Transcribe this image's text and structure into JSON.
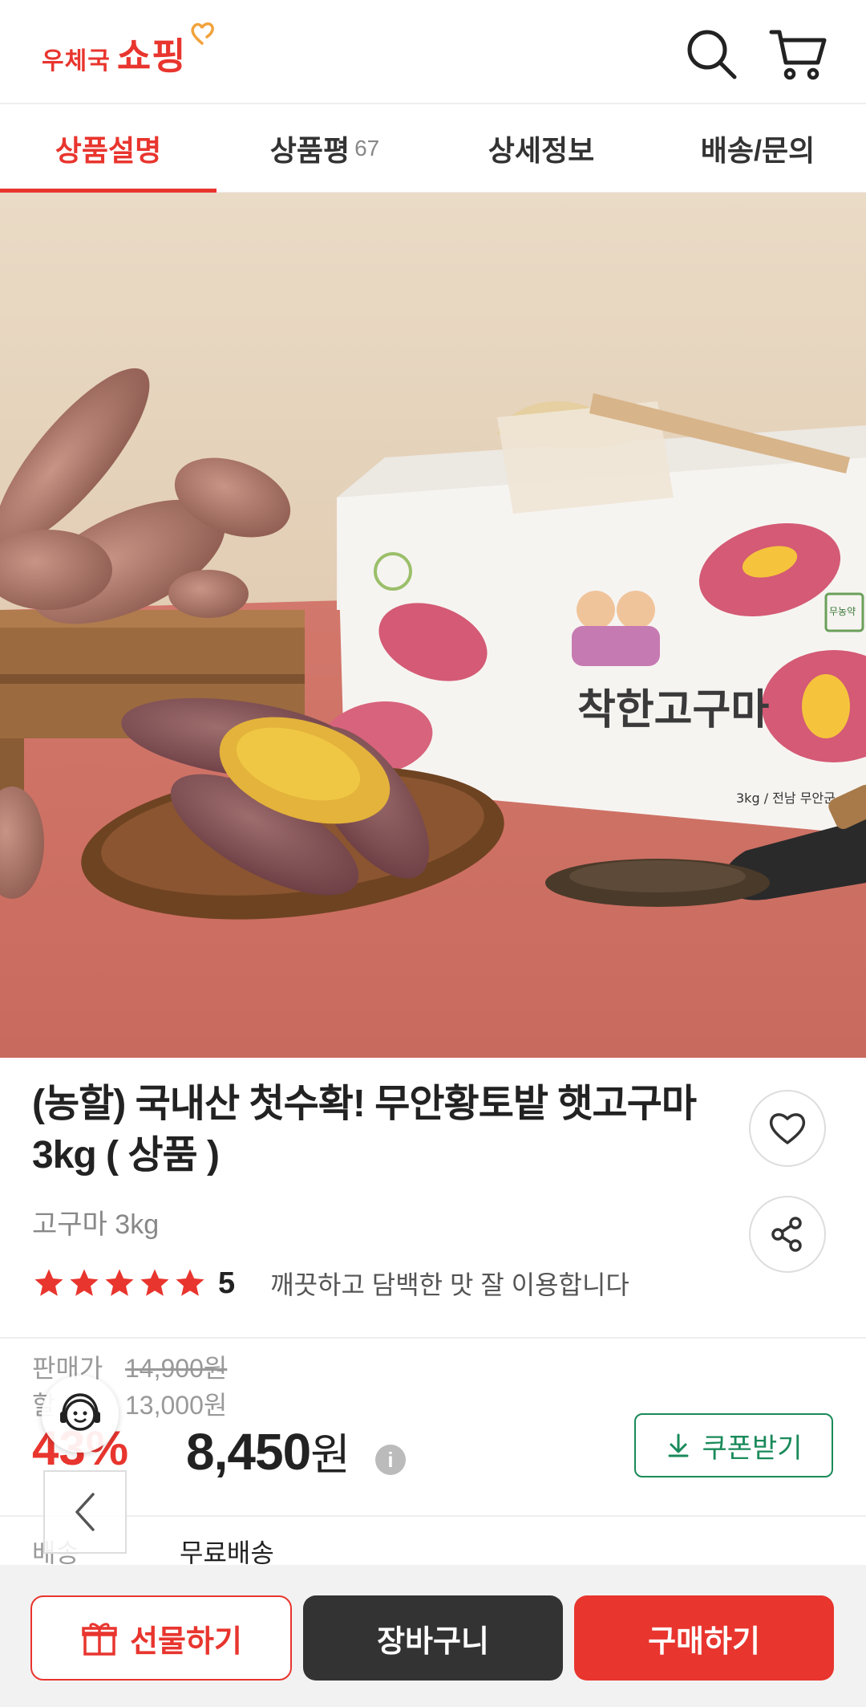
{
  "header": {
    "logo_small": "우체국",
    "logo_big": "쇼핑",
    "brand_color": "#e8352e"
  },
  "tabs": [
    {
      "label": "상품설명",
      "active": true
    },
    {
      "label": "상품평",
      "count": "67"
    },
    {
      "label": "상세정보"
    },
    {
      "label": "배송/문의"
    }
  ],
  "product": {
    "title_line1": "(농할) 국내산 첫수확! 무안황토밭 햇고구마",
    "title_line2": "3kg ( 상품 )",
    "subtitle": "고구마 3kg",
    "rating_stars": 5,
    "rating_score": "5",
    "review_snippet": "깨끗하고 담백한 맛 잘 이용합니다",
    "box_text": "착한고구마",
    "box_caption": "3kg / 전남 무안군",
    "box_badge": "무농약"
  },
  "pricing": {
    "sale_label": "판매가",
    "sale_price": "14,900원",
    "discount_label": "할",
    "discount_price": "13,000원",
    "discount_rate": "43%",
    "final_price": "8,450",
    "currency": "원",
    "info_icon": "i",
    "coupon_label": "쿠폰받기"
  },
  "shipping": {
    "label": "배송",
    "value": "무료배송"
  },
  "bottom": {
    "gift_label": "선물하기",
    "cart_label": "장바구니",
    "buy_label": "구매하기"
  }
}
